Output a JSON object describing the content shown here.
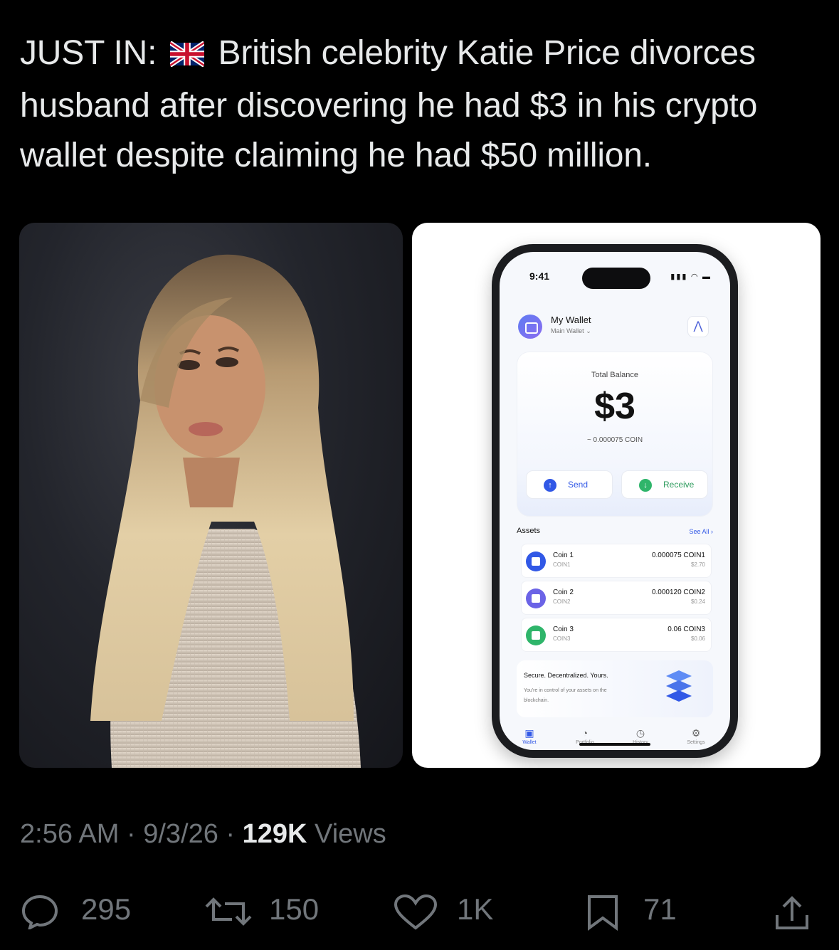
{
  "tweet": {
    "text_prefix": "JUST IN:",
    "text_body": "British celebrity Katie Price divorces husband after discovering he had $3 in his crypto wallet despite claiming he had $50 million.",
    "flag_icon": "uk-flag-icon"
  },
  "phone": {
    "time": "9:41",
    "wallet_title": "My Wallet",
    "wallet_sub": "Main Wallet",
    "total_label": "Total Balance",
    "total_value": "$3",
    "total_coin": "~ 0.000075 COIN",
    "send_label": "Send",
    "receive_label": "Receive",
    "assets_label": "Assets",
    "see_all": "See All",
    "assets": [
      {
        "name": "Coin 1",
        "symbol": "COIN1",
        "amount": "0.000075 COIN1",
        "usd": "$2.70",
        "color": "#3158e6"
      },
      {
        "name": "Coin 2",
        "symbol": "COIN2",
        "amount": "0.000120 COIN2",
        "usd": "$0.24",
        "color": "#6b63e6"
      },
      {
        "name": "Coin 3",
        "symbol": "COIN3",
        "amount": "0.06 COIN3",
        "usd": "$0.06",
        "color": "#2fb56a"
      }
    ],
    "secure_title": "Secure. Decentralized. Yours.",
    "secure_text": "You're in control of your assets on the blockchain.",
    "tabs": [
      "Wallet",
      "Portfolio",
      "History",
      "Settings"
    ]
  },
  "meta": {
    "time": "2:56 AM",
    "date": "9/3/26",
    "views_count": "129K",
    "views_label": "Views"
  },
  "actions": {
    "replies": "295",
    "reposts": "150",
    "likes": "1K",
    "bookmarks": "71"
  },
  "colors": {
    "background": "#000000",
    "text": "#e7e9ea",
    "muted": "#71767b",
    "accent_blue": "#3158e6",
    "accent_green": "#2fb56a"
  }
}
